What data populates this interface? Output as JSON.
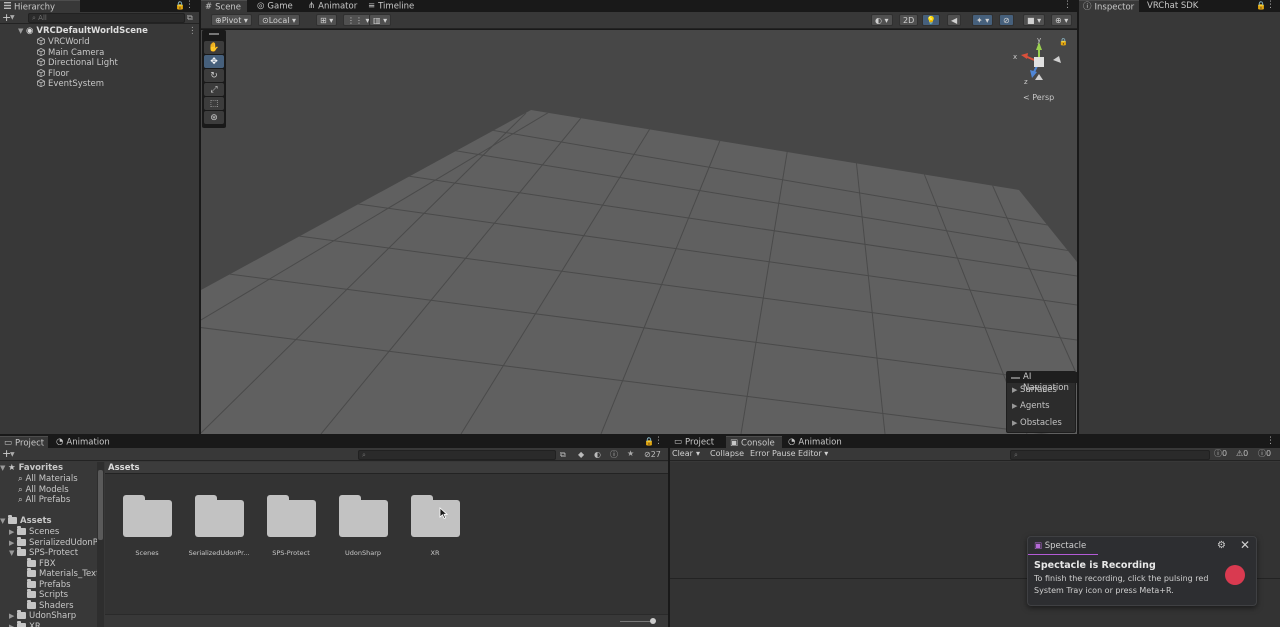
{
  "hierarchy": {
    "tab_label": "Hierarchy",
    "search_placeholder": "All",
    "scene_name": "VRCDefaultWorldScene",
    "items": [
      "VRCWorld",
      "Main Camera",
      "Directional Light",
      "Floor",
      "EventSystem"
    ]
  },
  "scene_tabs": [
    "Scene",
    "Game",
    "Animator",
    "Timeline"
  ],
  "scene_toolbar": {
    "pivot": "Pivot",
    "local": "Local",
    "mode_2d": "2D",
    "persp_label": "< Persp",
    "gizmo_axes": [
      "y",
      "x",
      "z"
    ]
  },
  "ai_navigation": {
    "title": "AI Navigation",
    "items": [
      "Surfaces",
      "Agents",
      "Obstacles"
    ]
  },
  "right_tabs": [
    "Inspector",
    "VRChat SDK"
  ],
  "project": {
    "tabs": [
      "Project",
      "Animation"
    ],
    "favorites_label": "Favorites",
    "favorites": [
      "All Materials",
      "All Models",
      "All Prefabs"
    ],
    "assets_label": "Assets",
    "tree": [
      "Scenes",
      "SerializedUdonPro",
      "SPS-Protect",
      "FBX",
      "Materials_Textu",
      "Prefabs",
      "Scripts",
      "Shaders",
      "UdonSharp",
      "XR"
    ],
    "breadcrumb": "Assets",
    "hidden_count": "27",
    "folders": [
      "Scenes",
      "SerializedUdonPr...",
      "SPS-Protect",
      "UdonSharp",
      "XR"
    ]
  },
  "console": {
    "tabs": [
      "Project",
      "Console",
      "Animation"
    ],
    "buttons": [
      "Clear",
      "Collapse",
      "Error Pause",
      "Editor"
    ],
    "counts": [
      "0",
      "0",
      "0"
    ]
  },
  "notification": {
    "app": "Spectacle",
    "title": "Spectacle is Recording",
    "body": "To finish the recording, click the pulsing red System Tray icon or press Meta+R.",
    "accent": "#d93a50"
  },
  "colors": {
    "panel_bg": "#383838",
    "dark_bg": "#191919",
    "scene_bg": "#474747",
    "active_tool": "#46607c"
  }
}
